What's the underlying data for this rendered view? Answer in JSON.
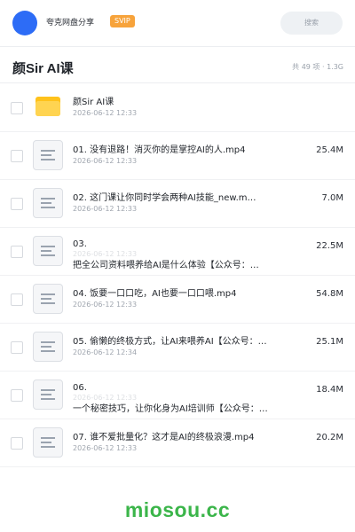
{
  "header": {
    "app_name": "夸克网盘分享",
    "badge": "SVIP",
    "search_placeholder": "搜索",
    "avatar_color": "#2d6cf6",
    "badge_color": "#f7a33b"
  },
  "folder": {
    "title": "颜Sir AI课",
    "stats": "共 49 项 · 1.3G"
  },
  "items": [
    {
      "type": "folder",
      "name": "颜Sir AI课",
      "date": "2026-06-12 12:33",
      "size": "",
      "icon": "folder-icon"
    },
    {
      "type": "file",
      "name": "01. 没有退路！消灭你的是掌控AI的人.mp4",
      "date": "2026-06-12 12:33",
      "size": "25.4M",
      "icon": "document-icon"
    },
    {
      "type": "file",
      "name": "02. 这门课让你同时学会两种AI技能_new.m…",
      "date": "2026-06-12 12:33",
      "size": "7.0M",
      "icon": "document-icon"
    },
    {
      "type": "file",
      "name_line1": "03.",
      "name_line2": "把全公司资料喂养给AI是什么体验【公众号：…",
      "date": "2026-06-12 12:33",
      "size": "22.5M",
      "icon": "document-icon"
    },
    {
      "type": "file",
      "name": "04. 饭要一口口吃，AI也要一口口喂.mp4",
      "date": "2026-06-12 12:33",
      "size": "54.8M",
      "icon": "document-icon"
    },
    {
      "type": "file",
      "name": "05. 偷懒的终极方式，让AI来喂养AI【公众号：…",
      "date": "2026-06-12 12:34",
      "size": "25.1M",
      "icon": "document-icon"
    },
    {
      "type": "file",
      "name_line1": "06.",
      "name_line2": "一个秘密技巧，让你化身为AI培训师【公众号：…",
      "date": "2026-06-12 12:33",
      "size": "18.4M",
      "icon": "document-icon"
    },
    {
      "type": "file",
      "name": "07. 谁不爱批量化？这才是AI的终极浪漫.mp4",
      "date": "2026-06-12 12:33",
      "size": "20.2M",
      "icon": "document-icon"
    }
  ],
  "watermark": "miosou.cc",
  "watermark_color": "#3bb54a"
}
